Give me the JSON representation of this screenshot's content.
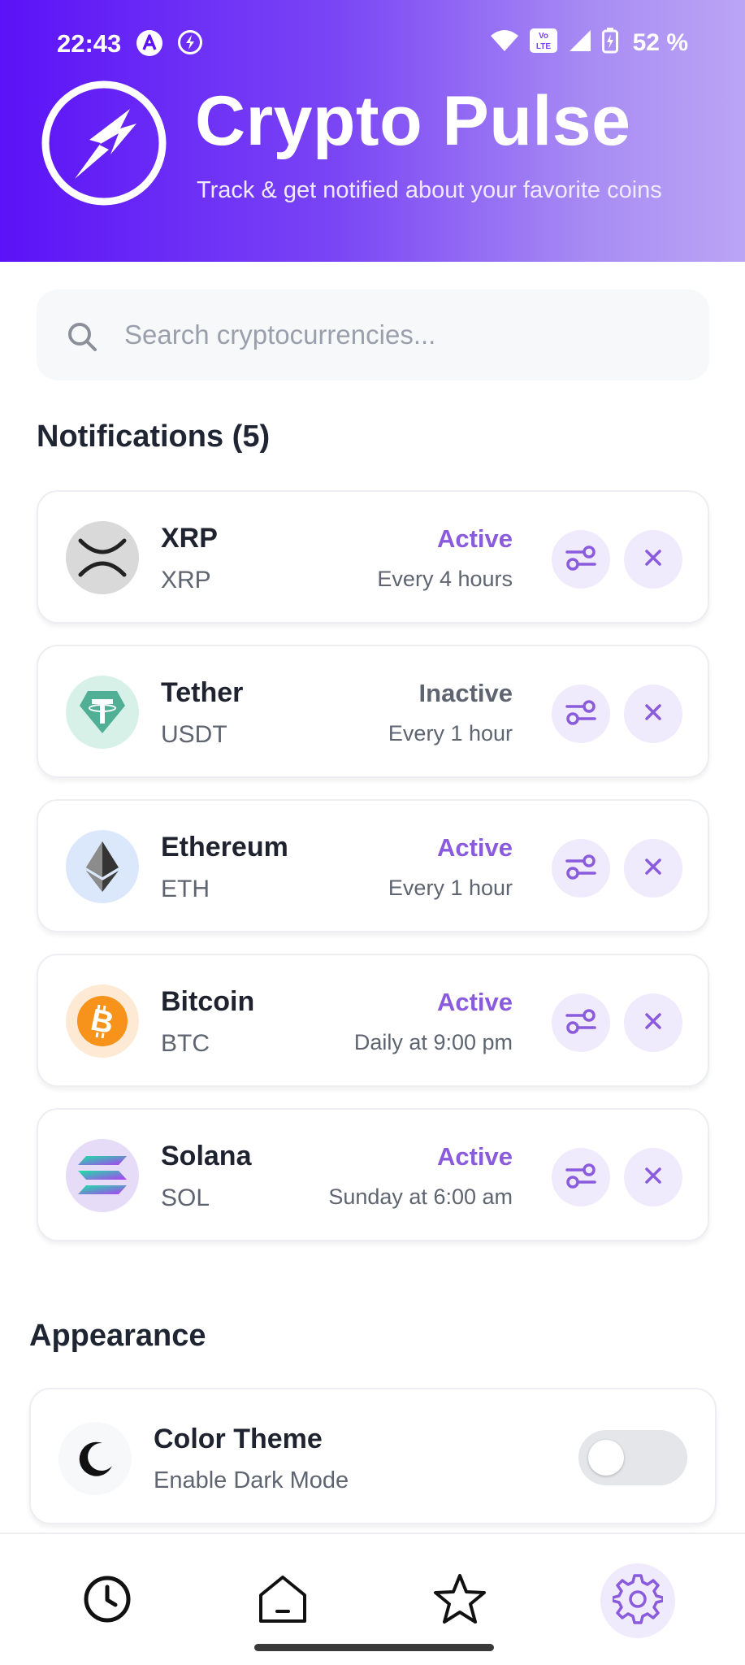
{
  "status_bar": {
    "time": "22:43",
    "battery": "52 %",
    "volte_label": "Vo LTE"
  },
  "header": {
    "title": "Crypto Pulse",
    "subtitle": "Track & get notified about your favorite coins"
  },
  "search": {
    "placeholder": "Search cryptocurrencies..."
  },
  "notifications": {
    "title": "Notifications (5)",
    "items": [
      {
        "name": "XRP",
        "symbol": "XRP",
        "status": "Active",
        "frequency": "Every 4 hours",
        "icon": "xrp-icon"
      },
      {
        "name": "Tether",
        "symbol": "USDT",
        "status": "Inactive",
        "frequency": "Every 1 hour",
        "icon": "tether-icon"
      },
      {
        "name": "Ethereum",
        "symbol": "ETH",
        "status": "Active",
        "frequency": "Every 1 hour",
        "icon": "ethereum-icon"
      },
      {
        "name": "Bitcoin",
        "symbol": "BTC",
        "status": "Active",
        "frequency": "Daily at 9:00 pm",
        "icon": "bitcoin-icon"
      },
      {
        "name": "Solana",
        "symbol": "SOL",
        "status": "Active",
        "frequency": "Sunday at 6:00 am",
        "icon": "solana-icon"
      }
    ]
  },
  "appearance": {
    "title": "Appearance",
    "theme_title": "Color Theme",
    "theme_subtitle": "Enable Dark Mode",
    "dark_mode_enabled": false
  },
  "bottom_nav": {
    "items": [
      "history-icon",
      "home-icon",
      "favorites-icon",
      "settings-icon"
    ],
    "active": "settings-icon"
  },
  "colors": {
    "accent": "#8a5bdc",
    "header_start": "#5b12f7",
    "header_end": "#bba5f5"
  }
}
